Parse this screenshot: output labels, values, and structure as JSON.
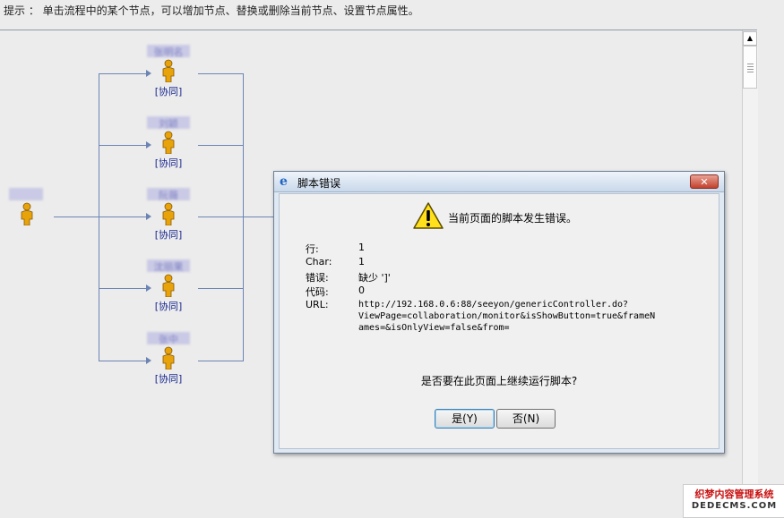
{
  "hint": "提示 ： 单击流程中的某个节点，可以增加节点、替换或删除当前节点、设置节点属性。",
  "workflow": {
    "start_name": "",
    "nodes": [
      {
        "name": "张明名",
        "tag": "[协同]"
      },
      {
        "name": "刘颖",
        "tag": "[协同]"
      },
      {
        "name": "阮薇",
        "tag": "[协同]"
      },
      {
        "name": "沈丽果",
        "tag": "[协同]"
      },
      {
        "name": "张中",
        "tag": "[协同]"
      }
    ]
  },
  "dialog": {
    "title": "脚本错误",
    "close_label": "✕",
    "headline": "当前页面的脚本发生错误。",
    "fields": [
      {
        "label": "行:",
        "value": "1"
      },
      {
        "label": "Char:",
        "value": "1"
      },
      {
        "label": "错误:",
        "value": "缺少 ']'"
      },
      {
        "label": "代码:",
        "value": "0"
      },
      {
        "label": "URL:",
        "value_lines": [
          "http://192.168.0.6:88/seeyon/genericController.do?",
          "ViewPage=collaboration/monitor&isShowButton=true&frameN",
          "ames=&isOnlyView=false&from="
        ]
      }
    ],
    "question": "是否要在此页面上继续运行脚本?",
    "yes_label": "是(Y)",
    "no_label": "否(N)"
  },
  "scrollbar": {
    "up_arrow": "▲"
  },
  "watermark": {
    "line1": "织梦内容管理系统",
    "line2": "DEDECMS.COM"
  },
  "colors": {
    "connector": "#6c84b4",
    "person_body": "#e8a20a",
    "tag_text": "#1b2a90"
  },
  "icons": [
    "person-icon",
    "warning-icon",
    "ie-icon",
    "close-icon"
  ]
}
